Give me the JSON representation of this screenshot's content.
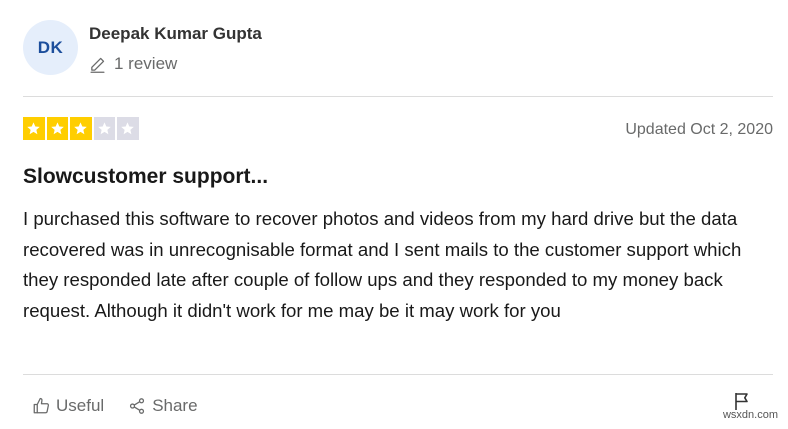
{
  "author": {
    "initials": "DK",
    "name": "Deepak Kumar Gupta",
    "review_count_label": "1 review"
  },
  "review": {
    "rating": 3,
    "max_rating": 5,
    "date_label": "Updated Oct 2, 2020",
    "title": "Slowcustomer support...",
    "body": "I purchased this software to recover photos and videos from my hard drive but the data recovered was in unrecognisable format and I sent mails to the customer support which they responded late after couple of follow ups and they responded to my money back request. Although it didn't work for me may be it may work for you"
  },
  "actions": {
    "useful_label": "Useful",
    "share_label": "Share"
  },
  "colors": {
    "star_filled": "#ffce00",
    "star_empty": "#dcdce6",
    "avatar_bg": "#e5eefb",
    "avatar_text": "#1c4e9c"
  },
  "icons": {
    "review_count": "pencil-icon",
    "useful": "thumbs-up-icon",
    "share": "share-icon",
    "report": "flag-icon",
    "star": "star-icon"
  },
  "watermark": "wsxdn.com"
}
